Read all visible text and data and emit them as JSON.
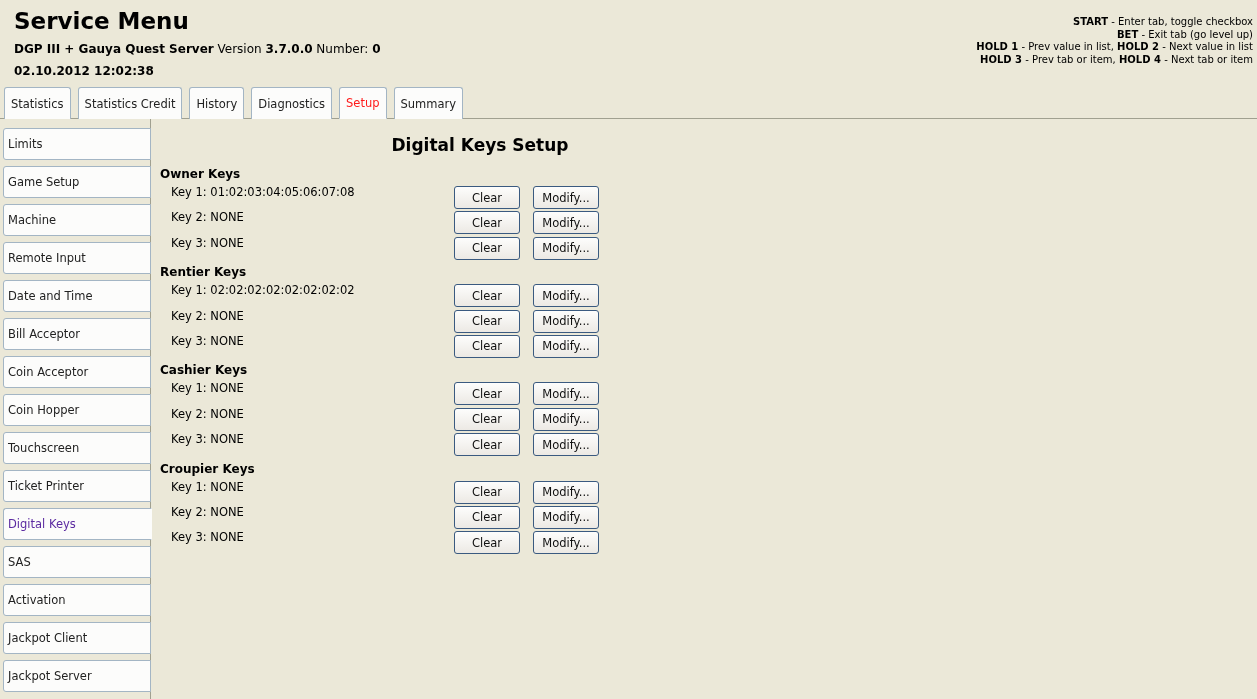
{
  "header": {
    "title": "Service Menu",
    "subtitle": "**DGP III + Gauya Quest Server** Version **3.7.0.0** Number: **0**",
    "datetime": "02.10.2012 12:02:38",
    "help": [
      "**START** - Enter tab, toggle checkbox",
      "**BET** - Exit tab (go level up)",
      "**HOLD 1** - Prev value in list, **HOLD 2** - Next value in list",
      "**HOLD 3** - Prev tab or item, **HOLD 4** - Next tab or item"
    ]
  },
  "tabs": [
    {
      "label": "Statistics",
      "selected": false
    },
    {
      "label": "Statistics Credit",
      "selected": false
    },
    {
      "label": "History",
      "selected": false
    },
    {
      "label": "Diagnostics",
      "selected": false
    },
    {
      "label": "Setup",
      "selected": true
    },
    {
      "label": "Summary",
      "selected": false
    }
  ],
  "sidebar": {
    "items": [
      {
        "label": "Limits",
        "selected": false
      },
      {
        "label": "Game Setup",
        "selected": false
      },
      {
        "label": "Machine",
        "selected": false
      },
      {
        "label": "Remote Input",
        "selected": false
      },
      {
        "label": "Date and Time",
        "selected": false
      },
      {
        "label": "Bill Acceptor",
        "selected": false
      },
      {
        "label": "Coin Acceptor",
        "selected": false
      },
      {
        "label": "Coin Hopper",
        "selected": false
      },
      {
        "label": "Touchscreen",
        "selected": false
      },
      {
        "label": "Ticket Printer",
        "selected": false
      },
      {
        "label": "Digital Keys",
        "selected": true
      },
      {
        "label": "SAS",
        "selected": false
      },
      {
        "label": "Activation",
        "selected": false
      },
      {
        "label": "Jackpot Client",
        "selected": false
      },
      {
        "label": "Jackpot Server",
        "selected": false
      }
    ]
  },
  "content": {
    "title": "Digital Keys Setup",
    "groups": [
      {
        "title": "Owner Keys",
        "keys": [
          {
            "label": "Key 1: 01:02:03:04:05:06:07:08",
            "clear": "Clear",
            "modify": "Modify..."
          },
          {
            "label": "Key 2: NONE",
            "clear": "Clear",
            "modify": "Modify..."
          },
          {
            "label": "Key 3: NONE",
            "clear": "Clear",
            "modify": "Modify..."
          }
        ]
      },
      {
        "title": "Rentier Keys",
        "keys": [
          {
            "label": "Key 1: 02:02:02:02:02:02:02:02",
            "clear": "Clear",
            "modify": "Modify..."
          },
          {
            "label": "Key 2: NONE",
            "clear": "Clear",
            "modify": "Modify..."
          },
          {
            "label": "Key 3: NONE",
            "clear": "Clear",
            "modify": "Modify..."
          }
        ]
      },
      {
        "title": "Cashier Keys",
        "keys": [
          {
            "label": "Key 1: NONE",
            "clear": "Clear",
            "modify": "Modify..."
          },
          {
            "label": "Key 2: NONE",
            "clear": "Clear",
            "modify": "Modify..."
          },
          {
            "label": "Key 3: NONE",
            "clear": "Clear",
            "modify": "Modify..."
          }
        ]
      },
      {
        "title": "Croupier Keys",
        "keys": [
          {
            "label": "Key 1: NONE",
            "clear": "Clear",
            "modify": "Modify..."
          },
          {
            "label": "Key 2: NONE",
            "clear": "Clear",
            "modify": "Modify..."
          },
          {
            "label": "Key 3: NONE",
            "clear": "Clear",
            "modify": "Modify..."
          }
        ]
      }
    ]
  }
}
